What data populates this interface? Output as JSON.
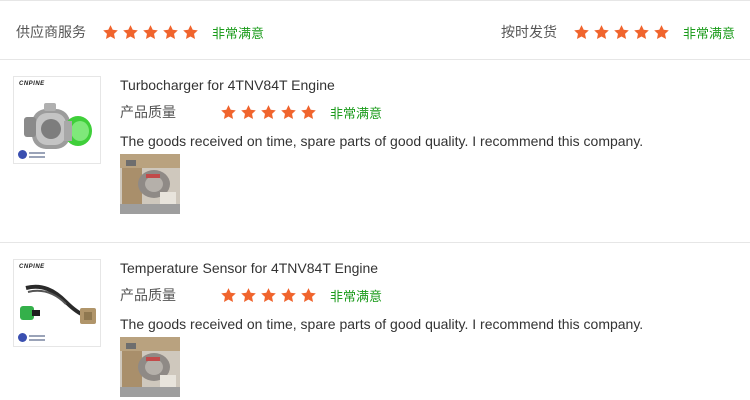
{
  "summary": {
    "service_label": "供应商服务",
    "service_rating_text": "非常满意",
    "service_stars": 5,
    "shipping_label": "按时发货",
    "shipping_rating_text": "非常满意",
    "shipping_stars": 5
  },
  "reviews": [
    {
      "product_title": "Turbocharger for 4TNV84T Engine",
      "brand": "CNPINE",
      "quality_label": "产品质量",
      "quality_rating_text": "非常满意",
      "quality_stars": 5,
      "comment": "The goods received on time, spare parts of good quality. I recommend this company."
    },
    {
      "product_title": "Temperature Sensor for 4TNV84T Engine",
      "brand": "CNPINE",
      "quality_label": "产品质量",
      "quality_rating_text": "非常满意",
      "quality_stars": 5,
      "comment": "The goods received on time, spare parts of good quality. I recommend this company."
    }
  ],
  "colors": {
    "star": "#f0642d",
    "rating_text": "#1a9b1a",
    "divider": "#e6e6e6"
  },
  "icons": {
    "star": "star-icon"
  }
}
